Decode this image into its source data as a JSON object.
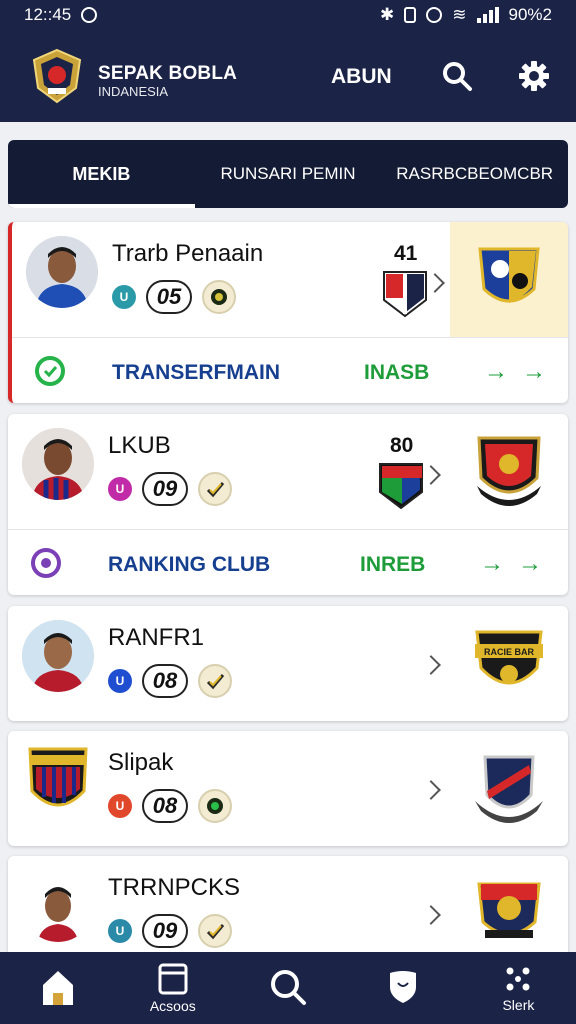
{
  "status_bar": {
    "time": "12::45",
    "battery": "90%2"
  },
  "header": {
    "brand_title": "SEPAK BOBLA",
    "brand_subtitle": "INDANESIA",
    "link_label": "ABUN",
    "icons": [
      "search-icon",
      "gear-icon"
    ]
  },
  "tabs": [
    {
      "label": "MEKIB",
      "active": true
    },
    {
      "label": "RUNSARI PEMIN",
      "active": false
    },
    {
      "label": "RASRBCBEOMCBR",
      "active": false
    }
  ],
  "cards": [
    {
      "title": "Trarb Penaain",
      "dot": "U",
      "number": "05",
      "score": "41",
      "footer": {
        "label": "TRANSERFMAIN",
        "code": "INASB"
      }
    },
    {
      "title": "LKUB",
      "dot": "U",
      "number": "09",
      "score": "80",
      "footer": {
        "label": "RANKING CLUB",
        "code": "INREB"
      }
    },
    {
      "title": "RANFR1",
      "dot": "U",
      "number": "08"
    },
    {
      "title": "Slipak",
      "dot": "U",
      "number": "08"
    },
    {
      "title": "TRRNPCKS",
      "dot": "U",
      "number": "09"
    }
  ],
  "crest_text": {
    "card3": "RACIE BAR"
  },
  "bottom_nav": [
    {
      "label": "",
      "icon": "home-icon"
    },
    {
      "label": "Acsoos",
      "icon": "card-icon"
    },
    {
      "label": "",
      "icon": "search-icon"
    },
    {
      "label": "",
      "icon": "shield-icon"
    },
    {
      "label": "Slerk",
      "icon": "grid-icon"
    }
  ],
  "colors": {
    "navy": "#1b2347",
    "tab_bar": "#141b34",
    "accent_red": "#d62828",
    "link_blue": "#163f8f",
    "success_green": "#1e9c3a"
  }
}
